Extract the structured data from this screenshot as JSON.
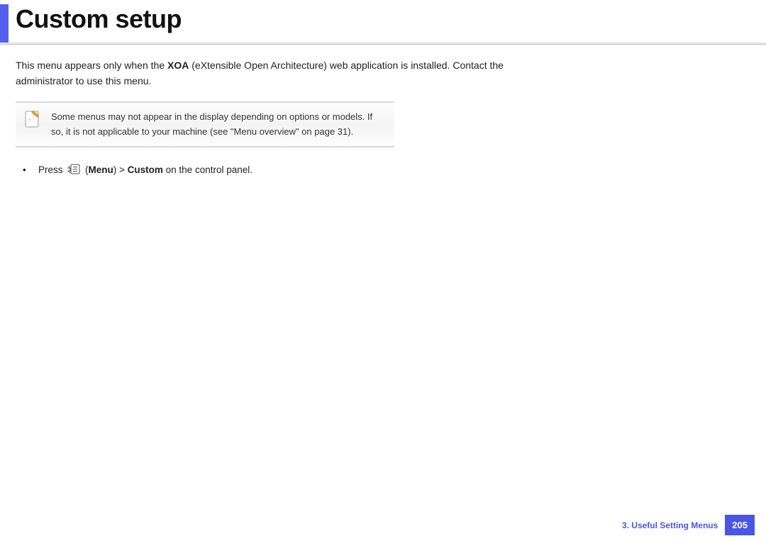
{
  "header": {
    "title": "Custom setup"
  },
  "intro": {
    "p1a": "This menu appears only when the ",
    "bold1": "XOA",
    "p1b": " (eXtensible Open Architecture) web application is installed. Contact the administrator to use this menu."
  },
  "note": {
    "text": "Some menus may not appear in the display depending on options or models. If so, it is not applicable to your machine (see \"Menu overview\" on page 31)."
  },
  "instruction": {
    "prefix": "Press ",
    "menu_label": "Menu",
    "middle": ") > ",
    "bold_target": "Custom",
    "suffix": " on the control panel."
  },
  "footer": {
    "chapter": "3.  Useful Setting Menus",
    "page": "205"
  }
}
